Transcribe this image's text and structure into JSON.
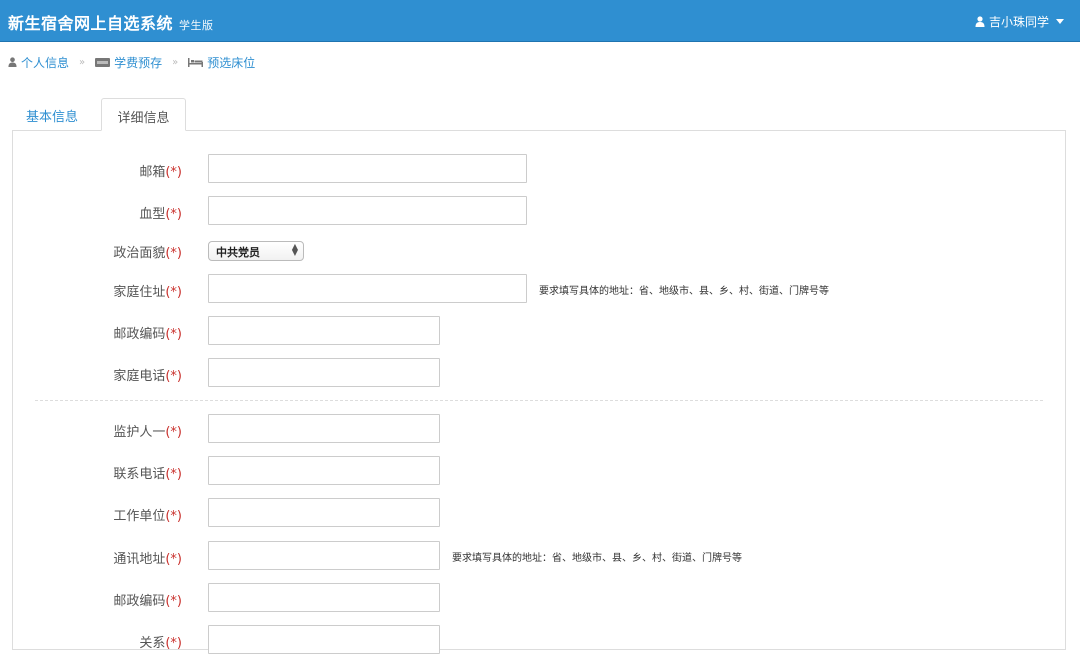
{
  "navbar": {
    "title": "新生宿舍网上自选系统",
    "subtitle": "学生版",
    "user": "吉小珠同学",
    "user_icon": "user-icon",
    "accent": "#2f8fd1"
  },
  "breadcrumb": {
    "items": [
      {
        "label": "个人信息",
        "icon": "user-icon"
      },
      {
        "label": "学费预存",
        "icon": "card-icon"
      },
      {
        "label": "预选床位",
        "icon": "bed-icon"
      }
    ],
    "separator": "»"
  },
  "tabs": [
    {
      "label": "基本信息",
      "active": false
    },
    {
      "label": "详细信息",
      "active": true
    }
  ],
  "form": {
    "required_mark": "(*)",
    "email_label": "邮箱",
    "blood_label": "血型",
    "political_label": "政治面貌",
    "political_value": "中共党员",
    "address_label": "家庭住址",
    "address_hint": "要求填写具体的地址：省、地级市、县、乡、村、街道、门牌号等",
    "postcode_label": "邮政编码",
    "phone_label": "家庭电话",
    "guardian_label": "监护人一",
    "contact_phone_label": "联系电话",
    "workplace_label": "工作单位",
    "mail_address_label": "通讯地址",
    "mail_address_hint": "要求填写具体的地址：省、地级市、县、乡、村、街道、门牌号等",
    "guardian_postcode_label": "邮政编码",
    "relation_label": "关系"
  }
}
